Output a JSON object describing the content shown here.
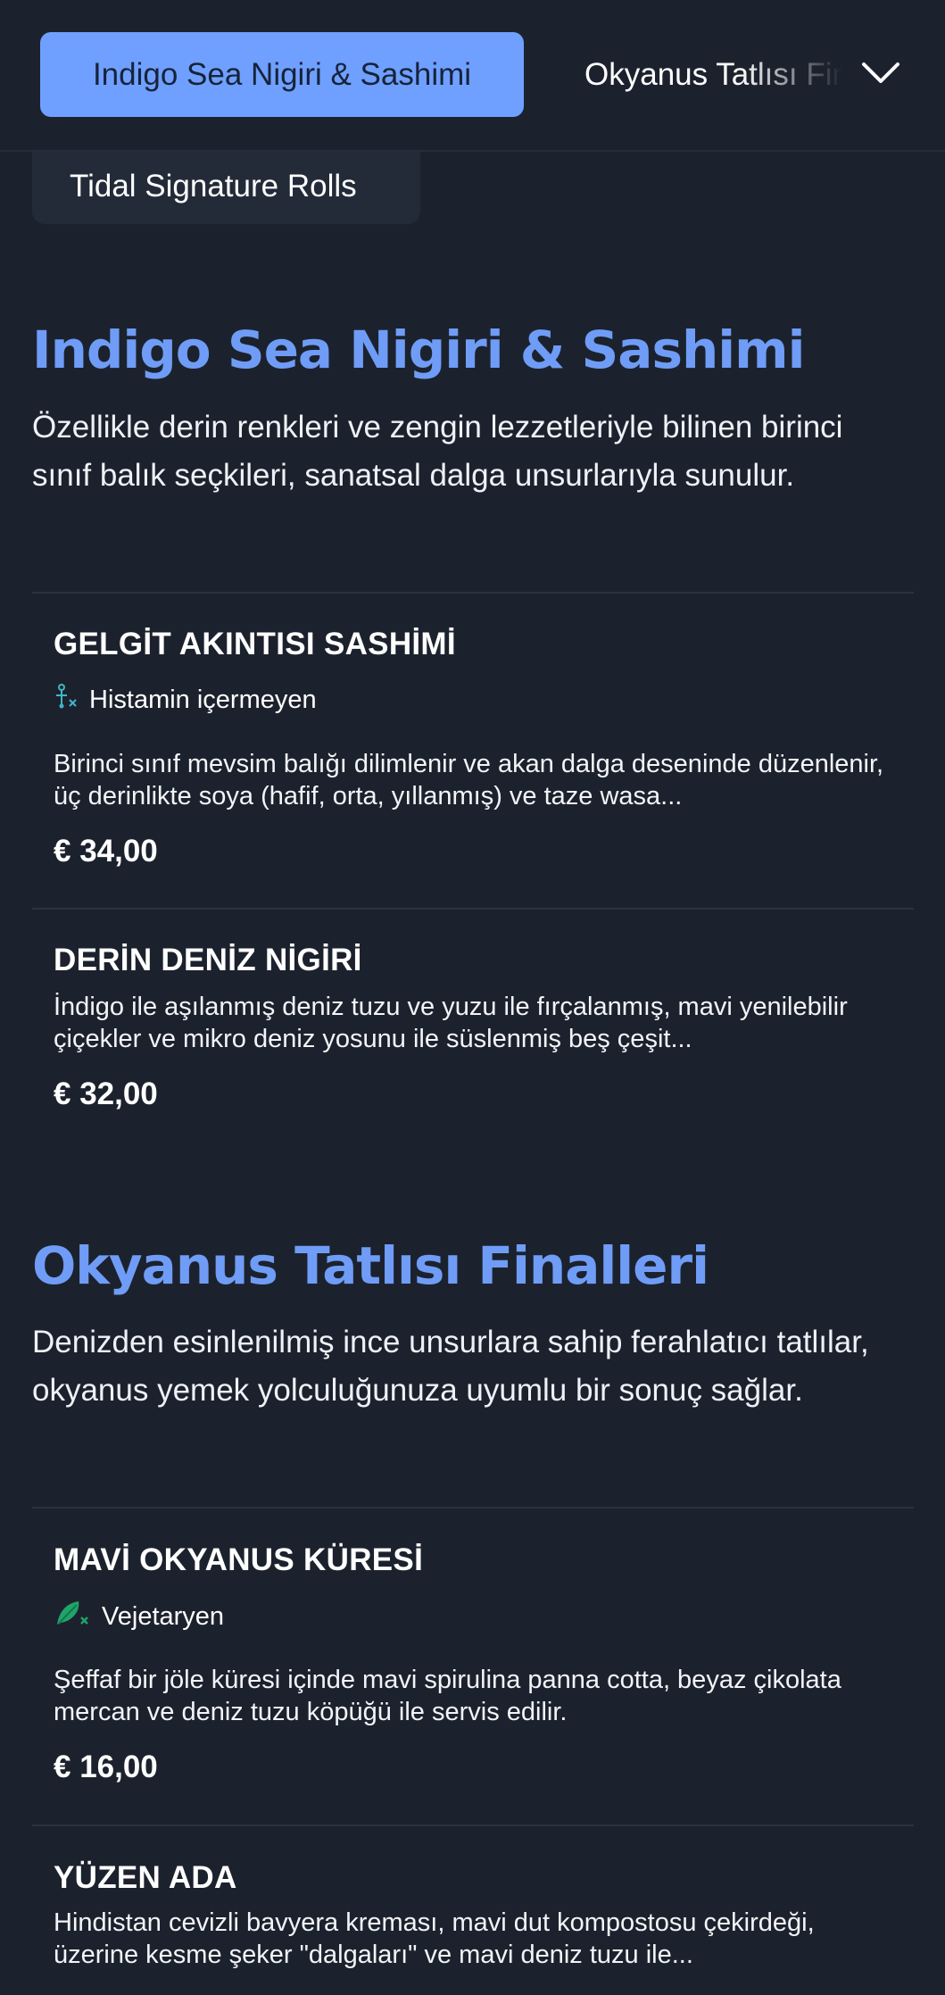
{
  "nav": {
    "active_tab": "Indigo Sea Nigiri & Sashimi",
    "next_tab": "Okyanus Tatlısı Finalleri",
    "extra_tab": "Tidal Signature Rolls"
  },
  "sections": [
    {
      "title": "Indigo Sea Nigiri & Sashimi",
      "description": "Özellikle derin renkleri ve zengin lezzetleriyle bilinen birinci sınıf balık seçkileri, sanatsal dalga unsurlarıyla sunulur.",
      "items": [
        {
          "name": "GELGİT AKINTISI SASHİMİ",
          "tag": "Histamin içermeyen",
          "tag_icon": "histamine-free-icon",
          "description": "Birinci sınıf mevsim balığı dilimlenir ve akan dalga deseninde düzenlenir, üç derinlikte soya (hafif, orta, yıllanmış) ve taze wasa...",
          "price": "€ 34,00"
        },
        {
          "name": "DERİN DENİZ NİGİRİ",
          "description": "İndigo ile aşılanmış deniz tuzu ve yuzu ile fırçalanmış, mavi yenilebilir çiçekler ve mikro deniz yosunu ile süslenmiş beş çeşit...",
          "price": "€ 32,00"
        }
      ]
    },
    {
      "title": "Okyanus Tatlısı Finalleri",
      "description": "Denizden esinlenilmiş ince unsurlara sahip ferahlatıcı tatlılar, okyanus yemek yolculuğunuza uyumlu bir sonuç sağlar.",
      "items": [
        {
          "name": "MAVİ OKYANUS KÜRESİ",
          "tag": "Vejetaryen",
          "tag_icon": "vegetarian-icon",
          "description": "Şeffaf bir jöle küresi içinde mavi spirulina panna cotta, beyaz çikolata mercan ve deniz tuzu köpüğü ile servis edilir.",
          "price": "€ 16,00"
        },
        {
          "name": "YÜZEN ADA",
          "description": "Hindistan cevizli bavyera kreması, mavi dut kompostosu çekirdeği, üzerine kesme şeker \"dalgaları\" ve mavi deniz tuzu ile..."
        }
      ]
    }
  ],
  "colors": {
    "background": "#1c222d",
    "accent": "#6fa0ff",
    "title": "#6f9cf6",
    "histamine_icon": "#3fb6c9",
    "vegetarian_icon": "#1fa46a"
  }
}
